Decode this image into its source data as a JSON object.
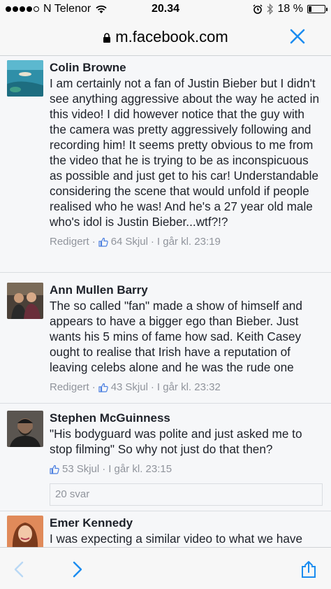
{
  "status": {
    "carrier": "N Telenor",
    "time": "20.34",
    "battery": "18 %",
    "battery_level": 0.18,
    "signal_bars": 4
  },
  "browser": {
    "url": "m.facebook.com",
    "close_icon": "close-icon",
    "lock_icon": "lock-icon",
    "back_icon": "chevron-left-icon",
    "forward_icon": "chevron-right-icon",
    "share_icon": "share-icon"
  },
  "comments": [
    {
      "name": "Colin Browne",
      "text": "I am certainly not a fan of Justin Bieber but I didn't see anything aggressive about the way he acted in this video! I did however notice that the guy with the camera was pretty aggressively following and recording him! It seems pretty obvious to me from the video that he is trying to be as inconspicuous as possible and just get to his car! Understandable considering the scene that would unfold if people realised who he was! And he's a 27 year old male who's idol is Justin Bieber...wtf?!?",
      "edited": "Redigert",
      "likes": "64",
      "hide": "Skjul",
      "time": "I går kl. 23:19"
    },
    {
      "name": "Ann Mullen Barry",
      "text": "The so called \"fan\" made a show of himself and appears to have a bigger ego than Bieber. Just wants his 5 mins of fame how sad. Keith Casey ought to realise that Irish have a reputation of leaving celebs alone and he was the rude one",
      "edited": "Redigert",
      "likes": "43",
      "hide": "Skjul",
      "time": "I går kl. 23:32"
    },
    {
      "name": "Stephen McGuinness",
      "text": "\"His bodyguard was polite and just asked me to stop filming\" So why not just do that then?",
      "likes": "53",
      "hide": "Skjul",
      "time": "I går kl. 23:15",
      "replies": "20 svar"
    },
    {
      "name": "Emer Kennedy",
      "text": "I was expecting a similar video to what we have"
    }
  ],
  "colors": {
    "accent": "#1a8cf0",
    "meta": "#90949c",
    "text": "#1d2129"
  }
}
